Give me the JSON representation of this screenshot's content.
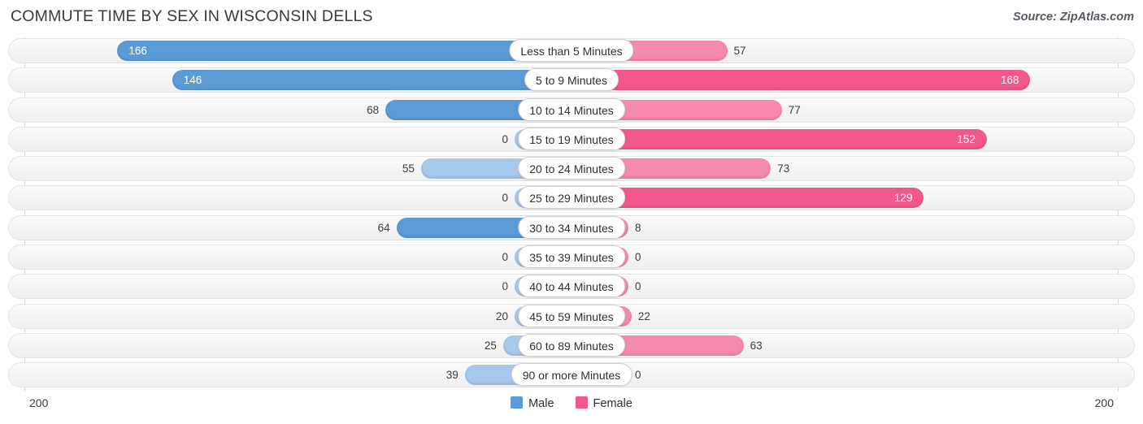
{
  "header": {
    "title": "COMMUTE TIME BY SEX IN WISCONSIN DELLS",
    "source": "Source: ZipAtlas.com"
  },
  "axis": {
    "left_label": "200",
    "right_label": "200",
    "max": 200
  },
  "legend": {
    "items": [
      {
        "label": "Male",
        "color": "#5b9bd5"
      },
      {
        "label": "Female",
        "color": "#f2578e"
      }
    ]
  },
  "colors": {
    "male_strong": "#5b9bd5",
    "male_light": "#a6c8ea",
    "female_strong": "#f2578e",
    "female_light": "#f589ae",
    "track_bg": "#f4f4f4",
    "track_border": "#e3e3e3"
  },
  "chart_data": {
    "type": "bar",
    "title": "COMMUTE TIME BY SEX IN WISCONSIN DELLS",
    "subtitle": "Source: ZipAtlas.com",
    "orientation": "horizontal-diverging",
    "xlabel": "",
    "ylabel": "",
    "xlim": [
      200,
      200
    ],
    "grid": false,
    "legend_position": "bottom-center",
    "categories": [
      "Less than 5 Minutes",
      "5 to 9 Minutes",
      "10 to 14 Minutes",
      "15 to 19 Minutes",
      "20 to 24 Minutes",
      "25 to 29 Minutes",
      "30 to 34 Minutes",
      "35 to 39 Minutes",
      "40 to 44 Minutes",
      "45 to 59 Minutes",
      "60 to 89 Minutes",
      "90 or more Minutes"
    ],
    "series": [
      {
        "name": "Male",
        "values": [
          166,
          146,
          68,
          0,
          55,
          0,
          64,
          0,
          0,
          20,
          25,
          39
        ]
      },
      {
        "name": "Female",
        "values": [
          57,
          168,
          77,
          152,
          73,
          129,
          8,
          0,
          0,
          22,
          63,
          0
        ]
      }
    ]
  },
  "rows": [
    {
      "label": "Less than 5 Minutes",
      "male": "166",
      "female": "57"
    },
    {
      "label": "5 to 9 Minutes",
      "male": "146",
      "female": "168"
    },
    {
      "label": "10 to 14 Minutes",
      "male": "68",
      "female": "77"
    },
    {
      "label": "15 to 19 Minutes",
      "male": "0",
      "female": "152"
    },
    {
      "label": "20 to 24 Minutes",
      "male": "55",
      "female": "73"
    },
    {
      "label": "25 to 29 Minutes",
      "male": "0",
      "female": "129"
    },
    {
      "label": "30 to 34 Minutes",
      "male": "64",
      "female": "8"
    },
    {
      "label": "35 to 39 Minutes",
      "male": "0",
      "female": "0"
    },
    {
      "label": "40 to 44 Minutes",
      "male": "0",
      "female": "0"
    },
    {
      "label": "45 to 59 Minutes",
      "male": "20",
      "female": "22"
    },
    {
      "label": "60 to 89 Minutes",
      "male": "25",
      "female": "63"
    },
    {
      "label": "90 or more Minutes",
      "male": "39",
      "female": "0"
    }
  ]
}
